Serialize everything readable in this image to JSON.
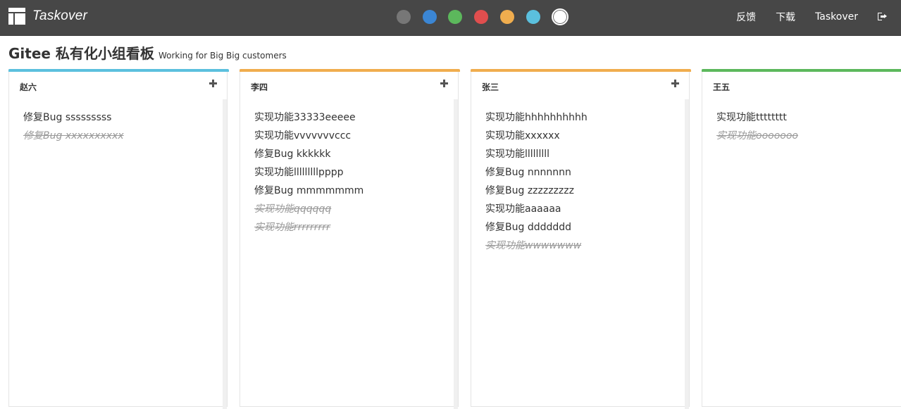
{
  "app": {
    "brand_name": "Taskover",
    "brand_icon": "board-layout-icon"
  },
  "theme_swatches": [
    {
      "color": "#777777",
      "active": false
    },
    {
      "color": "#3b86d4",
      "active": false
    },
    {
      "color": "#5cb85c",
      "active": false
    },
    {
      "color": "#e04e4e",
      "active": false
    },
    {
      "color": "#f0ad4e",
      "active": false
    },
    {
      "color": "#5bc0de",
      "active": false
    },
    {
      "color": "#ffffff",
      "active": true
    }
  ],
  "nav": {
    "feedback": "反馈",
    "download": "下载",
    "user": "Taskover",
    "logout_icon": "sign-out-icon"
  },
  "board": {
    "title": "Gitee 私有化小组看板",
    "subtitle": "Working for Big Big customers"
  },
  "columns": [
    {
      "name": "赵六",
      "color": "#5bc0de",
      "tasks": [
        {
          "text": "修复Bug sssssssss",
          "done": false
        },
        {
          "text": "修复Bug xxxxxxxxxx",
          "done": true
        }
      ]
    },
    {
      "name": "李四",
      "color": "#f0ad4e",
      "tasks": [
        {
          "text": "实现功能33333eeeee",
          "done": false
        },
        {
          "text": "实现功能vvvvvvvccc",
          "done": false
        },
        {
          "text": "修复Bug kkkkkk",
          "done": false
        },
        {
          "text": "实现功能lllllllllpppp",
          "done": false
        },
        {
          "text": "修复Bug mmmmmmm",
          "done": false
        },
        {
          "text": "实现功能qqqqqq",
          "done": true
        },
        {
          "text": "实现功能rrrrrrrrr",
          "done": true
        }
      ]
    },
    {
      "name": "张三",
      "color": "#f0ad4e",
      "tasks": [
        {
          "text": "实现功能hhhhhhhhhh",
          "done": false
        },
        {
          "text": "实现功能xxxxxx",
          "done": false
        },
        {
          "text": "实现功能lllllllll",
          "done": false
        },
        {
          "text": "修复Bug nnnnnnn",
          "done": false
        },
        {
          "text": "修复Bug zzzzzzzzz",
          "done": false
        },
        {
          "text": "实现功能aaaaaa",
          "done": false
        },
        {
          "text": "修复Bug ddddddd",
          "done": false
        },
        {
          "text": "实现功能wwwwwww",
          "done": true
        }
      ]
    },
    {
      "name": "王五",
      "color": "#5cb85c",
      "tasks": [
        {
          "text": "实现功能tttttttt",
          "done": false
        },
        {
          "text": "实现功能ooooooo",
          "done": true
        }
      ]
    }
  ]
}
